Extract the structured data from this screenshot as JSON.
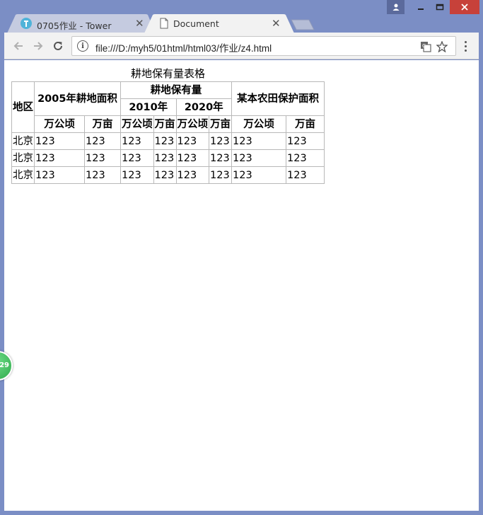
{
  "browser": {
    "tabs": [
      {
        "title": "0705作业 - Tower",
        "active": false
      },
      {
        "title": "Document",
        "active": true
      }
    ],
    "url": "file:///D:/myh5/01html/html03/作业/z4.html",
    "icons": {
      "back": "arrow-left-icon",
      "forward": "arrow-right-icon",
      "reload": "reload-icon",
      "info": "info-icon",
      "translate": "translate-icon",
      "bookmark": "star-icon",
      "menu": "kebab-menu-icon"
    },
    "colors": {
      "frame": "#7b8ec5",
      "close": "#c7413a"
    }
  },
  "document": {
    "caption": "耕地保有量表格",
    "headers": {
      "region": "地区",
      "area_2005": "2005年耕地面积",
      "retention": "耕地保有量",
      "year_2010": "2010年",
      "year_2020": "2020年",
      "farmland": "某本农田保护面积",
      "unit_wan_gongqing": "万公顷",
      "unit_wan_mu": "万亩"
    },
    "rows": [
      [
        "北京",
        "123",
        "123",
        "123",
        "123",
        "123",
        "123",
        "123",
        "123"
      ],
      [
        "北京",
        "123",
        "123",
        "123",
        "123",
        "123",
        "123",
        "123",
        "123"
      ],
      [
        "北京",
        "123",
        "123",
        "123",
        "123",
        "123",
        "123",
        "123",
        "123"
      ]
    ]
  },
  "badge": {
    "text": "29"
  }
}
